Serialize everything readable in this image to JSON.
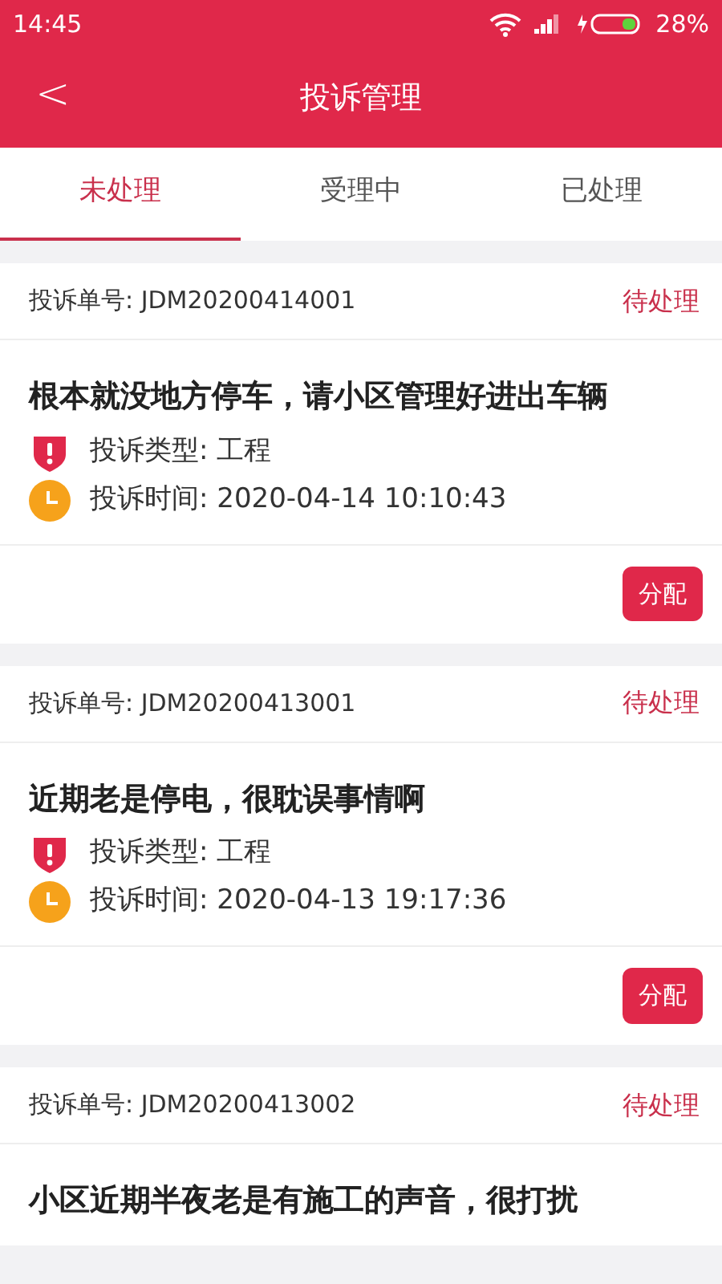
{
  "status_bar": {
    "time": "14:45",
    "battery": "28%"
  },
  "header": {
    "back": "<",
    "title": "投诉管理"
  },
  "tabs": [
    {
      "label": "未处理",
      "selected": true
    },
    {
      "label": "受理中",
      "selected": false
    },
    {
      "label": "已处理",
      "selected": false
    }
  ],
  "complaints": [
    {
      "number": "投诉单号: JDM20200414001",
      "status": "待处理",
      "title": "根本就没地方停车，请小区管理好进出车辆",
      "type": "投诉类型: 工程",
      "time": "投诉时间: 2020-04-14 10:10:43",
      "action": "分配"
    },
    {
      "number": "投诉单号: JDM20200413001",
      "status": "待处理",
      "title": "近期老是停电，很耽误事情啊",
      "type": "投诉类型: 工程",
      "time": "投诉时间: 2020-04-13 19:17:36",
      "action": "分配"
    },
    {
      "number": "投诉单号: JDM20200413002",
      "status": "待处理",
      "title": "小区近期半夜老是有施工的声音，很打扰"
    }
  ]
}
